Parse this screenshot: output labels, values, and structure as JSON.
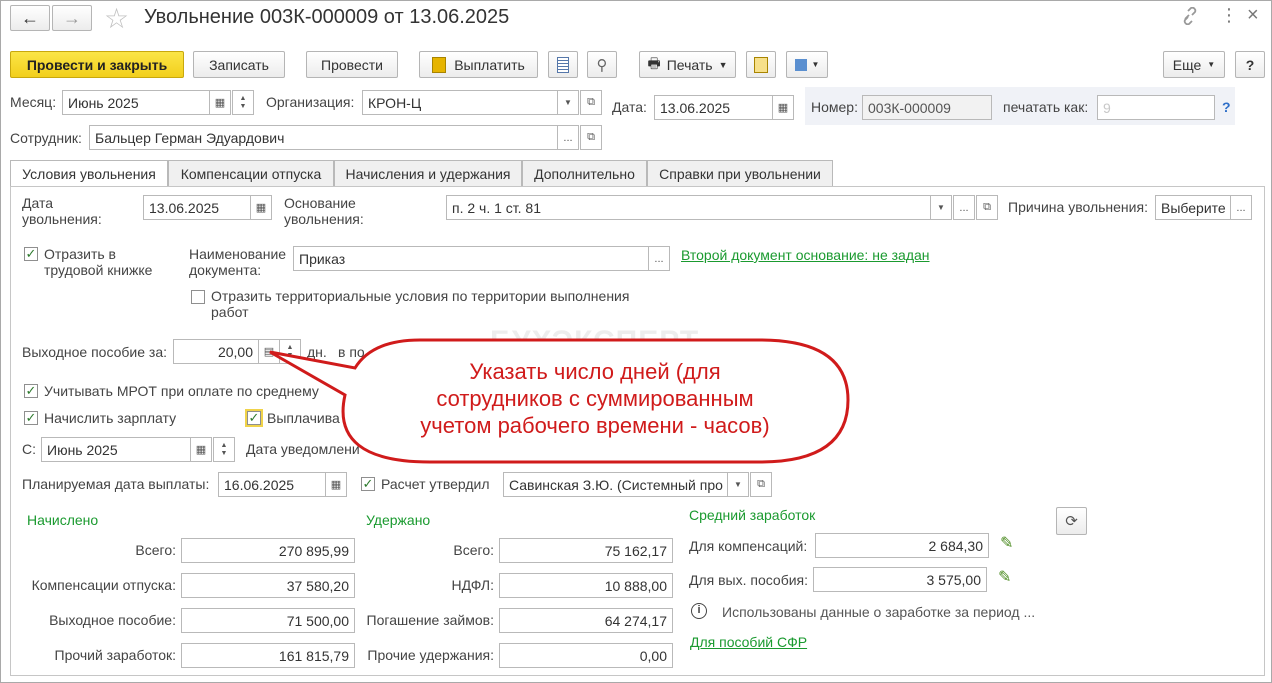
{
  "window": {
    "title": "Увольнение 003К-000009 от 13.06.2025",
    "nav_back": "←",
    "nav_forward": "→",
    "star": "☆"
  },
  "toolbar": {
    "post_close": "Провести и закрыть",
    "save": "Записать",
    "post": "Провести",
    "pay": "Выплатить",
    "print": "Печать",
    "more": "Еще",
    "help": "?"
  },
  "header": {
    "month_label": "Месяц:",
    "month_value": "Июнь 2025",
    "org_label": "Организация:",
    "org_value": "КРОН-Ц",
    "date_label": "Дата:",
    "date_value": "13.06.2025",
    "number_label": "Номер:",
    "number_value": "003К-000009",
    "print_as_label": "печатать как:",
    "print_as_placeholder": "9",
    "print_as_help": "?",
    "employee_label": "Сотрудник:",
    "employee_value": "Бальцер Герман Эдуардович"
  },
  "tabs": [
    {
      "label": "Условия увольнения"
    },
    {
      "label": "Компенсации отпуска"
    },
    {
      "label": "Начисления и удержания"
    },
    {
      "label": "Дополнительно"
    },
    {
      "label": "Справки при увольнении"
    }
  ],
  "form": {
    "dismissal_date_label": "Дата\nувольнения:",
    "dismissal_date_value": "13.06.2025",
    "basis_label": "Основание\nувольнения:",
    "basis_value": "п. 2 ч. 1 ст. 81",
    "reason_label": "Причина увольнения:",
    "reason_value": "Выберите",
    "workbook_label": "Отразить в\nтрудовой книжке",
    "doc_name_label": "Наименование\nдокумента:",
    "doc_name_value": "Приказ",
    "second_doc_link": "Второй документ основание: не задан",
    "territory_label": "Отразить территориальные условия по территории выполнения\nработ",
    "severance_label": "Выходное пособие за:",
    "severance_value": "20,00",
    "severance_unit": "дн.",
    "severance_after": "в по",
    "mrot_label": "Учитывать МРОТ при оплате по среднему",
    "salary_label": "Начислить зарплату",
    "pay_label": "Выплачива",
    "from_label": "С:",
    "from_value": "Июнь 2025",
    "notify_label": "Дата уведомлени",
    "planned_pay_label": "Планируемая дата выплаты:",
    "planned_pay_value": "16.06.2025",
    "approved_label": "Расчет утвердил",
    "approved_value": "Савинская З.Ю. (Системный про"
  },
  "accrued": {
    "title": "Начислено",
    "rows": [
      {
        "label": "Всего:",
        "value": "270 895,99"
      },
      {
        "label": "Компенсации отпуска:",
        "value": "37 580,20"
      },
      {
        "label": "Выходное пособие:",
        "value": "71 500,00"
      },
      {
        "label": "Прочий заработок:",
        "value": "161 815,79"
      }
    ]
  },
  "withheld": {
    "title": "Удержано",
    "rows": [
      {
        "label": "Всего:",
        "value": "75 162,17"
      },
      {
        "label": "НДФЛ:",
        "value": "10 888,00"
      },
      {
        "label": "Погашение займов:",
        "value": "64 274,17"
      },
      {
        "label": "Прочие удержания:",
        "value": "0,00"
      }
    ]
  },
  "average": {
    "title": "Средний заработок",
    "comp_label": "Для компенсаций:",
    "comp_value": "2 684,30",
    "sev_label": "Для вых. пособия:",
    "sev_value": "3 575,00",
    "info_text": "Использованы данные о заработке за период ...",
    "sfr_link": "Для пособий СФР"
  },
  "watermark": "БУХЭКСПЕРТ",
  "callout": {
    "line1": "Указать число дней (для",
    "line2": "сотрудников с суммированным",
    "line3": "учетом рабочего времени - часов)"
  },
  "colors": {
    "accent_yellow": "#f5d626",
    "link_green": "#1a9a2f",
    "callout_red": "#d01b1b"
  }
}
